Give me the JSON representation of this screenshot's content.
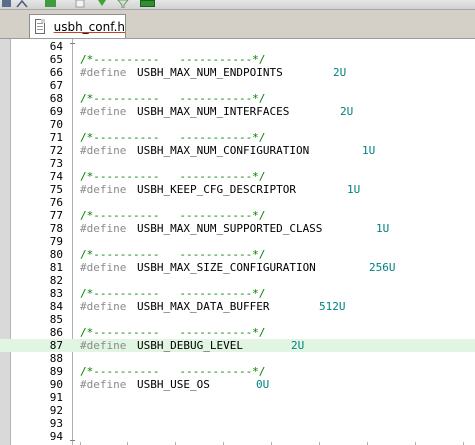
{
  "toolbar": {
    "icons": [
      "connect-icon",
      "tools-icon",
      "green-square-icon",
      "blank-page-icon",
      "arrow-down-icon",
      "funnel-icon",
      "check-icon"
    ]
  },
  "tabs": [
    {
      "label": "usbh_conf.h",
      "active": true
    }
  ],
  "colors": {
    "comment": "#008000",
    "keyword": "#8b8b8b",
    "value": "#008080",
    "current_line": "#e2f5e2"
  },
  "editor": {
    "lines": [
      {
        "num": "64",
        "comment": "",
        "kw": "",
        "macro": "",
        "value": ""
      },
      {
        "num": "65",
        "comment": "/*----------   -----------*/",
        "kw": "",
        "macro": "",
        "value": ""
      },
      {
        "num": "66",
        "comment": "",
        "kw": "#define",
        "macro": "USBH_MAX_NUM_ENDPOINTS",
        "value": "2U"
      },
      {
        "num": "67",
        "comment": "",
        "kw": "",
        "macro": "",
        "value": ""
      },
      {
        "num": "68",
        "comment": "/*----------   -----------*/",
        "kw": "",
        "macro": "",
        "value": ""
      },
      {
        "num": "69",
        "comment": "",
        "kw": "#define",
        "macro": "USBH_MAX_NUM_INTERFACES",
        "value": "2U"
      },
      {
        "num": "70",
        "comment": "",
        "kw": "",
        "macro": "",
        "value": ""
      },
      {
        "num": "71",
        "comment": "/*----------   -----------*/",
        "kw": "",
        "macro": "",
        "value": ""
      },
      {
        "num": "72",
        "comment": "",
        "kw": "#define",
        "macro": "USBH_MAX_NUM_CONFIGURATION",
        "value": "1U"
      },
      {
        "num": "73",
        "comment": "",
        "kw": "",
        "macro": "",
        "value": ""
      },
      {
        "num": "74",
        "comment": "/*----------   -----------*/",
        "kw": "",
        "macro": "",
        "value": ""
      },
      {
        "num": "75",
        "comment": "",
        "kw": "#define",
        "macro": "USBH_KEEP_CFG_DESCRIPTOR",
        "value": "1U"
      },
      {
        "num": "76",
        "comment": "",
        "kw": "",
        "macro": "",
        "value": ""
      },
      {
        "num": "77",
        "comment": "/*----------   -----------*/",
        "kw": "",
        "macro": "",
        "value": ""
      },
      {
        "num": "78",
        "comment": "",
        "kw": "#define",
        "macro": "USBH_MAX_NUM_SUPPORTED_CLASS",
        "value": "1U"
      },
      {
        "num": "79",
        "comment": "",
        "kw": "",
        "macro": "",
        "value": ""
      },
      {
        "num": "80",
        "comment": "/*----------   -----------*/",
        "kw": "",
        "macro": "",
        "value": ""
      },
      {
        "num": "81",
        "comment": "",
        "kw": "#define",
        "macro": "USBH_MAX_SIZE_CONFIGURATION",
        "value": "256U"
      },
      {
        "num": "82",
        "comment": "",
        "kw": "",
        "macro": "",
        "value": ""
      },
      {
        "num": "83",
        "comment": "/*----------   -----------*/",
        "kw": "",
        "macro": "",
        "value": ""
      },
      {
        "num": "84",
        "comment": "",
        "kw": "#define",
        "macro": "USBH_MAX_DATA_BUFFER",
        "value": "512U"
      },
      {
        "num": "85",
        "comment": "",
        "kw": "",
        "macro": "",
        "value": ""
      },
      {
        "num": "86",
        "comment": "/*----------   -----------*/",
        "kw": "",
        "macro": "",
        "value": ""
      },
      {
        "num": "87",
        "comment": "",
        "kw": "#define",
        "macro": "USBH_DEBUG_LEVEL",
        "value": "2U",
        "current": true
      },
      {
        "num": "88",
        "comment": "",
        "kw": "",
        "macro": "",
        "value": ""
      },
      {
        "num": "89",
        "comment": "/*----------   -----------*/",
        "kw": "",
        "macro": "",
        "value": ""
      },
      {
        "num": "90",
        "comment": "",
        "kw": "#define",
        "macro": "USBH_USE_OS",
        "value": "0U"
      },
      {
        "num": "91",
        "comment": "",
        "kw": "",
        "macro": "",
        "value": ""
      },
      {
        "num": "92",
        "comment": "",
        "kw": "",
        "macro": "",
        "value": ""
      },
      {
        "num": "93",
        "comment": "",
        "kw": "",
        "macro": "",
        "value": ""
      },
      {
        "num": "94",
        "comment": "",
        "kw": "",
        "macro": "",
        "value": ""
      }
    ]
  }
}
